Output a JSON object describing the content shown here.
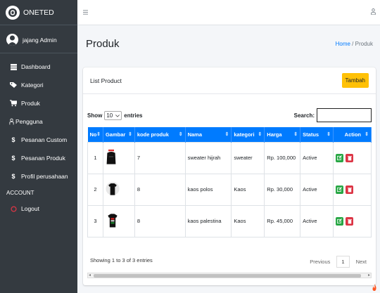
{
  "brand": {
    "name": "ONETED"
  },
  "user": {
    "name": "jajang Admin"
  },
  "sidebar": {
    "items": [
      {
        "label": "Dashboard",
        "icon": "table-icon"
      },
      {
        "label": "Kategori",
        "icon": "tag-icon"
      },
      {
        "label": "Produk",
        "icon": "cart-icon"
      },
      {
        "label": "Pengguna",
        "icon": "user-icon"
      },
      {
        "label": "Pesanan Custom",
        "icon": "dollar-icon"
      },
      {
        "label": "Pesanan Produk",
        "icon": "dollar-icon"
      },
      {
        "label": "Profil perusahaan",
        "icon": "dollar-icon"
      }
    ],
    "account_header": "ACCOUNT",
    "logout": {
      "label": "Logout",
      "icon": "circle-icon"
    }
  },
  "header": {
    "title": "Produk",
    "breadcrumb": {
      "home": "Home",
      "separator": "/",
      "current": "Produk"
    }
  },
  "card": {
    "title": "List Product",
    "add_button": "Tambah"
  },
  "datatable": {
    "show_label": "Show",
    "entries_value": "10",
    "entries_label": "entries",
    "search_label": "Search:",
    "search_value": "",
    "columns": [
      "No",
      "Gambar",
      "kode produk",
      "Nama",
      "kategori",
      "Harga",
      "Status",
      "Action"
    ],
    "rows": [
      {
        "no": "1",
        "image": "black-sweater-image",
        "kode": "7",
        "nama": "sweater hijrah",
        "kategori": "sweater",
        "harga": "Rp. 100,000",
        "status": "Active"
      },
      {
        "no": "2",
        "image": "black-tshirt-image",
        "kode": "8",
        "nama": "kaos polos",
        "kategori": "Kaos",
        "harga": "Rp. 30,000",
        "status": "Active"
      },
      {
        "no": "3",
        "image": "printed-tshirt-image",
        "kode": "8",
        "nama": "kaos palestina",
        "kategori": "Kaos",
        "harga": "Rp. 45,000",
        "status": "Active"
      }
    ],
    "info": "Showing 1 to 3 of 3 entries",
    "pagination": {
      "previous": "Previous",
      "page": "1",
      "next": "Next"
    }
  },
  "colors": {
    "sidebar_bg": "#343a40",
    "primary": "#007bff",
    "warning": "#ffc107",
    "success": "#28a745",
    "danger": "#dc3545"
  }
}
